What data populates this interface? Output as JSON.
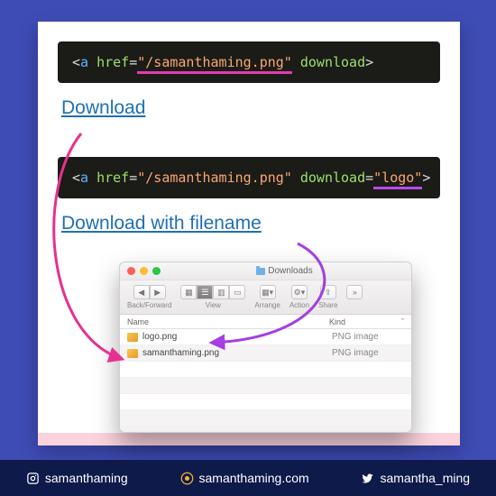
{
  "code1": {
    "tag": "a",
    "href_attr": "href",
    "href_val": "\"/samanthaming.png\"",
    "dl_attr": "download"
  },
  "link1": "Download",
  "code2": {
    "tag": "a",
    "href_attr": "href",
    "href_val": "\"/samanthaming.png\"",
    "dl_attr": "download",
    "dl_val": "\"logo\""
  },
  "link2": "Download with filename",
  "finder": {
    "title": "Downloads",
    "toolbar": {
      "back_label": "Back/Forward",
      "view_label": "View",
      "arrange_label": "Arrange",
      "action_label": "Action",
      "share_label": "Share"
    },
    "columns": {
      "name": "Name",
      "kind": "Kind"
    },
    "rows": [
      {
        "name": "logo.png",
        "kind": "PNG image"
      },
      {
        "name": "samanthaming.png",
        "kind": "PNG image"
      }
    ]
  },
  "footer": {
    "instagram": "samanthaming",
    "site": "samanthaming.com",
    "twitter": "samantha_ming"
  }
}
